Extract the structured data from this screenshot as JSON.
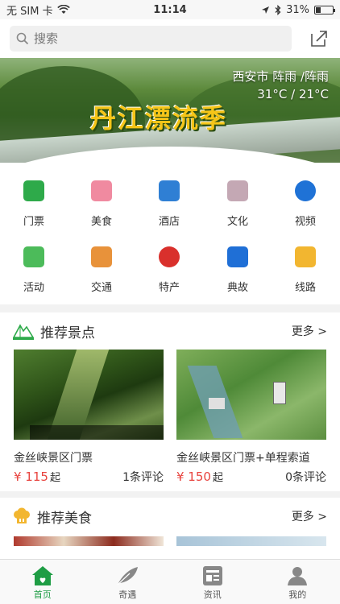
{
  "status": {
    "carrier": "无 SIM 卡",
    "time": "11:14",
    "battery": "31%",
    "battery_level": 0.31
  },
  "search": {
    "placeholder": "搜索"
  },
  "banner": {
    "title": "丹江漂流季",
    "city_weather": "西安市  阵雨 /阵雨",
    "temperature": "31°C / 21°C"
  },
  "categories": [
    {
      "label": "门票",
      "icon": "ticket-icon",
      "color": "#2eaa4a"
    },
    {
      "label": "美食",
      "icon": "cake-icon",
      "color": "#f08aa0"
    },
    {
      "label": "酒店",
      "icon": "hotel-icon",
      "color": "#2f7fd4"
    },
    {
      "label": "文化",
      "icon": "book-icon",
      "color": "#c4a8b4"
    },
    {
      "label": "视频",
      "icon": "video-icon",
      "color": "#1f72d6"
    },
    {
      "label": "活动",
      "icon": "gift-icon",
      "color": "#4cbb5a"
    },
    {
      "label": "交通",
      "icon": "bus-icon",
      "color": "#e8923a"
    },
    {
      "label": "特产",
      "icon": "cherry-icon",
      "color": "#d9302c"
    },
    {
      "label": "典故",
      "icon": "story-icon",
      "color": "#1f6fd6"
    },
    {
      "label": "线路",
      "icon": "route-icon",
      "color": "#f2b630"
    }
  ],
  "recommend_spots": {
    "title": "推荐景点",
    "more": "更多 >",
    "items": [
      {
        "name": "金丝峡景区门票",
        "price": "¥ 115",
        "price_suffix": "起",
        "comments": "1条评论"
      },
      {
        "name": "金丝峡景区门票+单程索道",
        "price": "¥ 150",
        "price_suffix": "起",
        "comments": "0条评论"
      }
    ]
  },
  "recommend_food": {
    "title": "推荐美食",
    "more": "更多 >"
  },
  "tabs": [
    {
      "label": "首页",
      "active": true
    },
    {
      "label": "奇遇",
      "active": false
    },
    {
      "label": "资讯",
      "active": false
    },
    {
      "label": "我的",
      "active": false
    }
  ],
  "colors": {
    "accent": "#1f9d45",
    "price": "#e8443f"
  }
}
